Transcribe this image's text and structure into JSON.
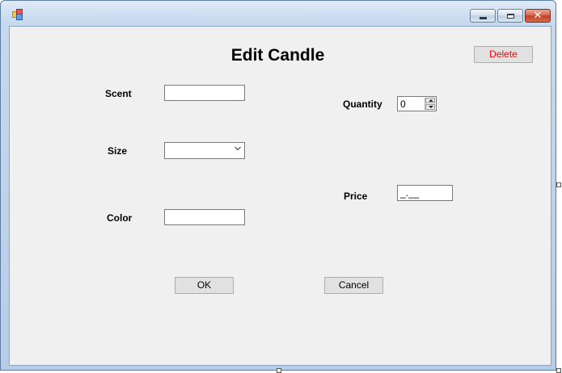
{
  "window": {
    "icon": "form-app-icon",
    "controls": {
      "minimize": "minimize-icon",
      "maximize": "maximize-icon",
      "close": "close-icon"
    }
  },
  "form": {
    "title": "Edit Candle",
    "delete_label": "Delete",
    "delete_color": "#ff0000",
    "labels": {
      "scent": "Scent",
      "size": "Size",
      "color": "Color",
      "quantity": "Quantity",
      "price": "Price"
    },
    "fields": {
      "scent_value": "",
      "size_value": "",
      "color_value": "",
      "quantity_value": "0",
      "price_mask": "_.__"
    },
    "ok_label": "OK",
    "cancel_label": "Cancel"
  }
}
